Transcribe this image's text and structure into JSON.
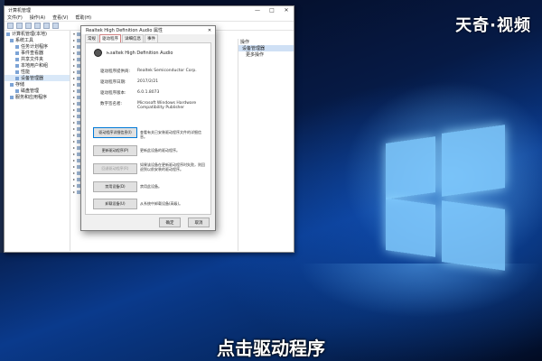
{
  "watermark": "天奇·视频",
  "caption": "点击驱动程序",
  "main_window": {
    "title": "计算机管理",
    "window_buttons": [
      "—",
      "□",
      "✕"
    ],
    "menu": [
      "文件(F)",
      "操作(A)",
      "查看(V)",
      "帮助(H)"
    ],
    "tree": [
      {
        "label": "计算机管理(本地)",
        "indent": 0
      },
      {
        "label": "系统工具",
        "indent": 1
      },
      {
        "label": "任务计划程序",
        "indent": 2
      },
      {
        "label": "事件查看器",
        "indent": 2
      },
      {
        "label": "共享文件夹",
        "indent": 2
      },
      {
        "label": "本地用户和组",
        "indent": 2
      },
      {
        "label": "性能",
        "indent": 2
      },
      {
        "label": "设备管理器",
        "indent": 2
      },
      {
        "label": "存储",
        "indent": 1
      },
      {
        "label": "磁盘管理",
        "indent": 2
      },
      {
        "label": "服务和应用程序",
        "indent": 1
      }
    ],
    "actions": {
      "title": "操作",
      "section": "设备管理器",
      "item": "更多操作"
    }
  },
  "dialog": {
    "title": "Realtek High Definition Audio 属性",
    "close": "✕",
    "tabs": [
      "常规",
      "驱动程序",
      "详细信息",
      "事件"
    ],
    "active_tab": "驱动程序",
    "device_name": "Realtek High Definition Audio",
    "properties": [
      {
        "key": "驱动程序提供商:",
        "value": "Realtek Semiconductor Corp."
      },
      {
        "key": "驱动程序日期:",
        "value": "2017/2/21"
      },
      {
        "key": "驱动程序版本:",
        "value": "6.0.1.8073"
      },
      {
        "key": "数字签名者:",
        "value": "Microsoft Windows Hardware Compatibility Publisher"
      }
    ],
    "buttons": [
      {
        "label": "驱动程序详细信息(I)",
        "desc": "查看有关已安装驱动程序文件的详细信息。"
      },
      {
        "label": "更新驱动程序(P)",
        "desc": "更新此设备的驱动程序。"
      },
      {
        "label": "回退驱动程序(R)",
        "desc": "如果该设备在更新驱动程序时失败，则回退到以前安装的驱动程序。"
      },
      {
        "label": "禁用设备(D)",
        "desc": "禁用此设备。"
      },
      {
        "label": "卸载设备(U)",
        "desc": "从系统中卸载设备(高级)。"
      }
    ],
    "ok": "确定",
    "cancel": "取消"
  }
}
